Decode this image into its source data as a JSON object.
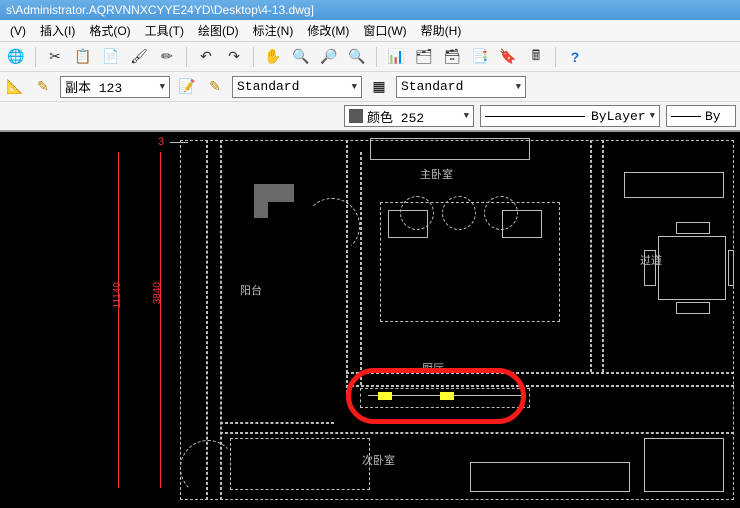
{
  "title": "s\\Administrator.AQRVNNXCYYE24YD\\Desktop\\4-13.dwg]",
  "menu": {
    "view": "(V)",
    "insert": "插入(I)",
    "format": "格式(O)",
    "tools": "工具(T)",
    "draw": "绘图(D)",
    "dimension": "标注(N)",
    "modify": "修改(M)",
    "window": "窗口(W)",
    "help": "帮助(H)"
  },
  "style": {
    "dim_style": "副本 123",
    "text_style1": "Standard",
    "text_style2": "Standard"
  },
  "props": {
    "color_label": "颜色 252",
    "linetype": "ByLayer",
    "lineweight": "By"
  },
  "dims": {
    "d1": "11140",
    "d2": "3840",
    "d3": "3"
  },
  "rooms": {
    "master": "主卧室",
    "balcony": "阳台",
    "corridor": "过道",
    "kitchen": "厨厅",
    "bed2": "次卧室"
  }
}
